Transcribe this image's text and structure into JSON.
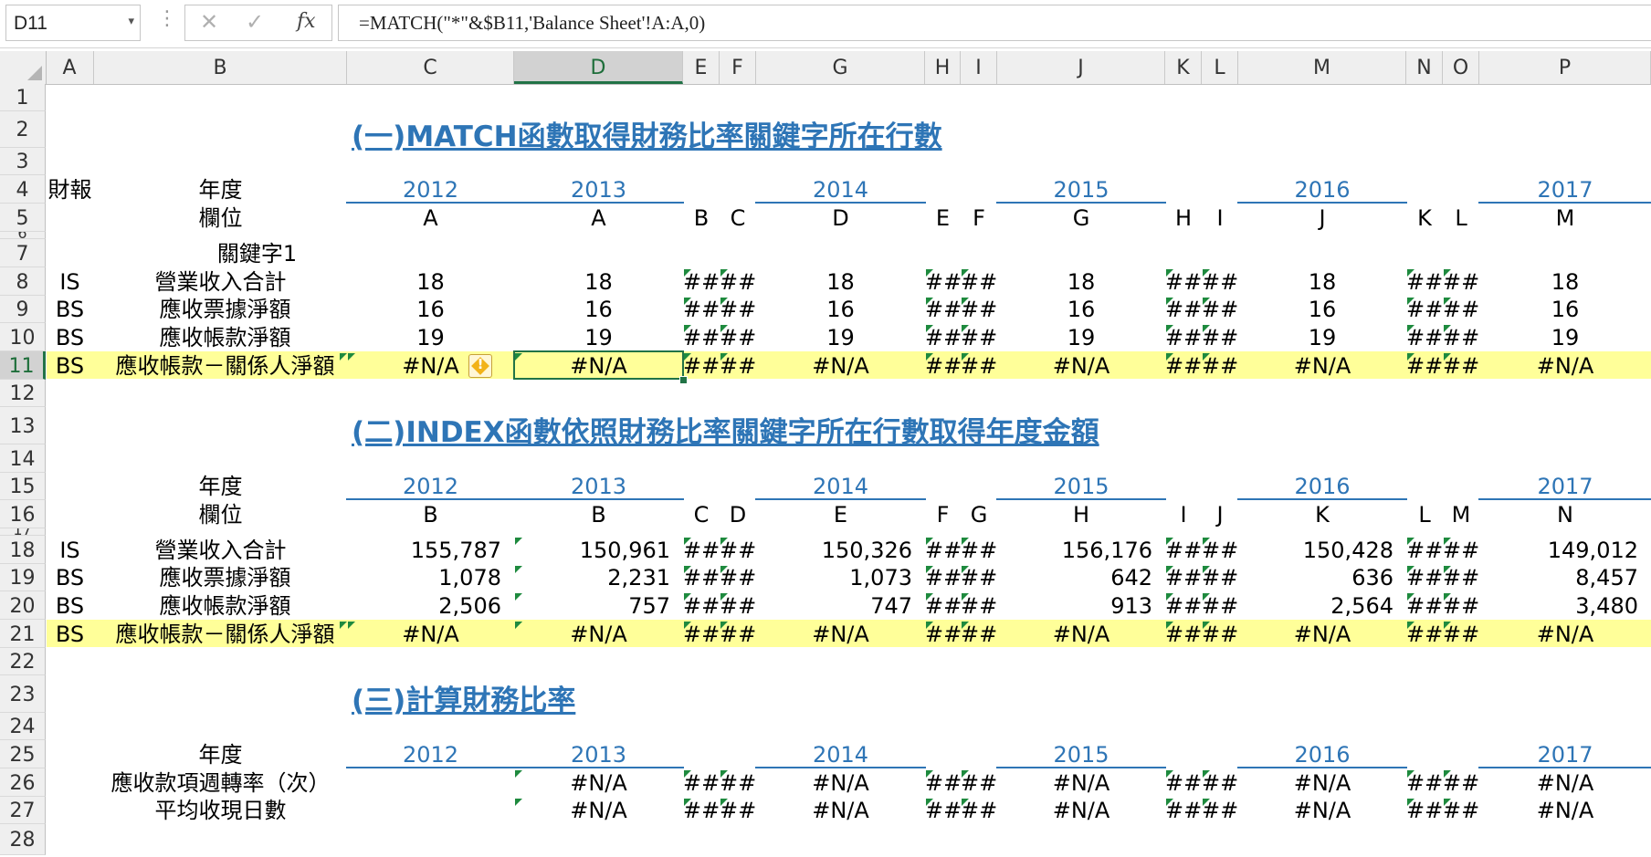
{
  "formula_bar": {
    "name_box": "D11",
    "cancel_icon": "✕",
    "confirm_icon": "✓",
    "fx_label": "fx",
    "formula": "=MATCH(\"*\"&$B11,'Balance Sheet'!A:A,0)"
  },
  "columns": [
    "A",
    "B",
    "C",
    "D",
    "E",
    "F",
    "G",
    "H",
    "I",
    "J",
    "K",
    "L",
    "M",
    "N",
    "O",
    "P"
  ],
  "selected_cell": "D11",
  "sections": {
    "s1": {
      "title": "(一)MATCH函數取得財務比率關鍵字所在行數"
    },
    "s2": {
      "title": "(二)INDEX函數依照財務比率關鍵字所在行數取得年度金額"
    },
    "s3": {
      "title": "(三)計算財務比率"
    }
  },
  "labels": {
    "caibao": "財報",
    "niandu": "年度",
    "lanwei": "欄位",
    "keyword": "關鍵字1"
  },
  "years": [
    "2012",
    "2013",
    "2014",
    "2015",
    "2016",
    "2017"
  ],
  "row5_codes": {
    "C": "A",
    "D": "A",
    "E": "B",
    "F": "C",
    "G": "D",
    "H": "E",
    "I": "F",
    "J": "G",
    "K": "H",
    "L": "I",
    "M": "J",
    "N": "K",
    "O": "L",
    "P": "M"
  },
  "row16_codes": {
    "C": "B",
    "D": "B",
    "E": "C",
    "F": "D",
    "G": "E",
    "H": "F",
    "I": "G",
    "J": "H",
    "K": "I",
    "L": "J",
    "M": "K",
    "N": "L",
    "O": "M",
    "P": "N"
  },
  "items": [
    {
      "type": "IS",
      "name": "營業收入合計"
    },
    {
      "type": "BS",
      "name": "應收票據淨額"
    },
    {
      "type": "BS",
      "name": "應收帳款淨額"
    },
    {
      "type": "BS",
      "name": "應收帳款－關係人淨額"
    }
  ],
  "match_rows": [
    [
      "18",
      "18",
      "18",
      "18",
      "18",
      "18"
    ],
    [
      "16",
      "16",
      "16",
      "16",
      "16",
      "16"
    ],
    [
      "19",
      "19",
      "19",
      "19",
      "19",
      "19"
    ],
    [
      "#N/A",
      "#N/A",
      "#N/A",
      "#N/A",
      "#N/A",
      "#N/A"
    ]
  ],
  "index_rows": [
    [
      "155,787",
      "150,961",
      "150,326",
      "156,176",
      "150,428",
      "149,012"
    ],
    [
      "1,078",
      "2,231",
      "1,073",
      "642",
      "636",
      "8,457"
    ],
    [
      "2,506",
      "757",
      "747",
      "913",
      "2,564",
      "3,480"
    ],
    [
      "#N/A",
      "#N/A",
      "#N/A",
      "#N/A",
      "#N/A",
      "#N/A"
    ]
  ],
  "ratios": [
    {
      "name": "應收款項週轉率（次）",
      "values": [
        "",
        "#N/A",
        "#N/A",
        "#N/A",
        "#N/A",
        "#N/A"
      ]
    },
    {
      "name": "平均收現日數",
      "values": [
        "",
        "#N/A",
        "#N/A",
        "#N/A",
        "#N/A",
        "#N/A"
      ]
    }
  ],
  "hash": "##",
  "colors": {
    "year_blue": "#2e75b6",
    "highlight": "#ffff99",
    "select_green": "#217346",
    "error_tri": "#1e8a3e"
  }
}
